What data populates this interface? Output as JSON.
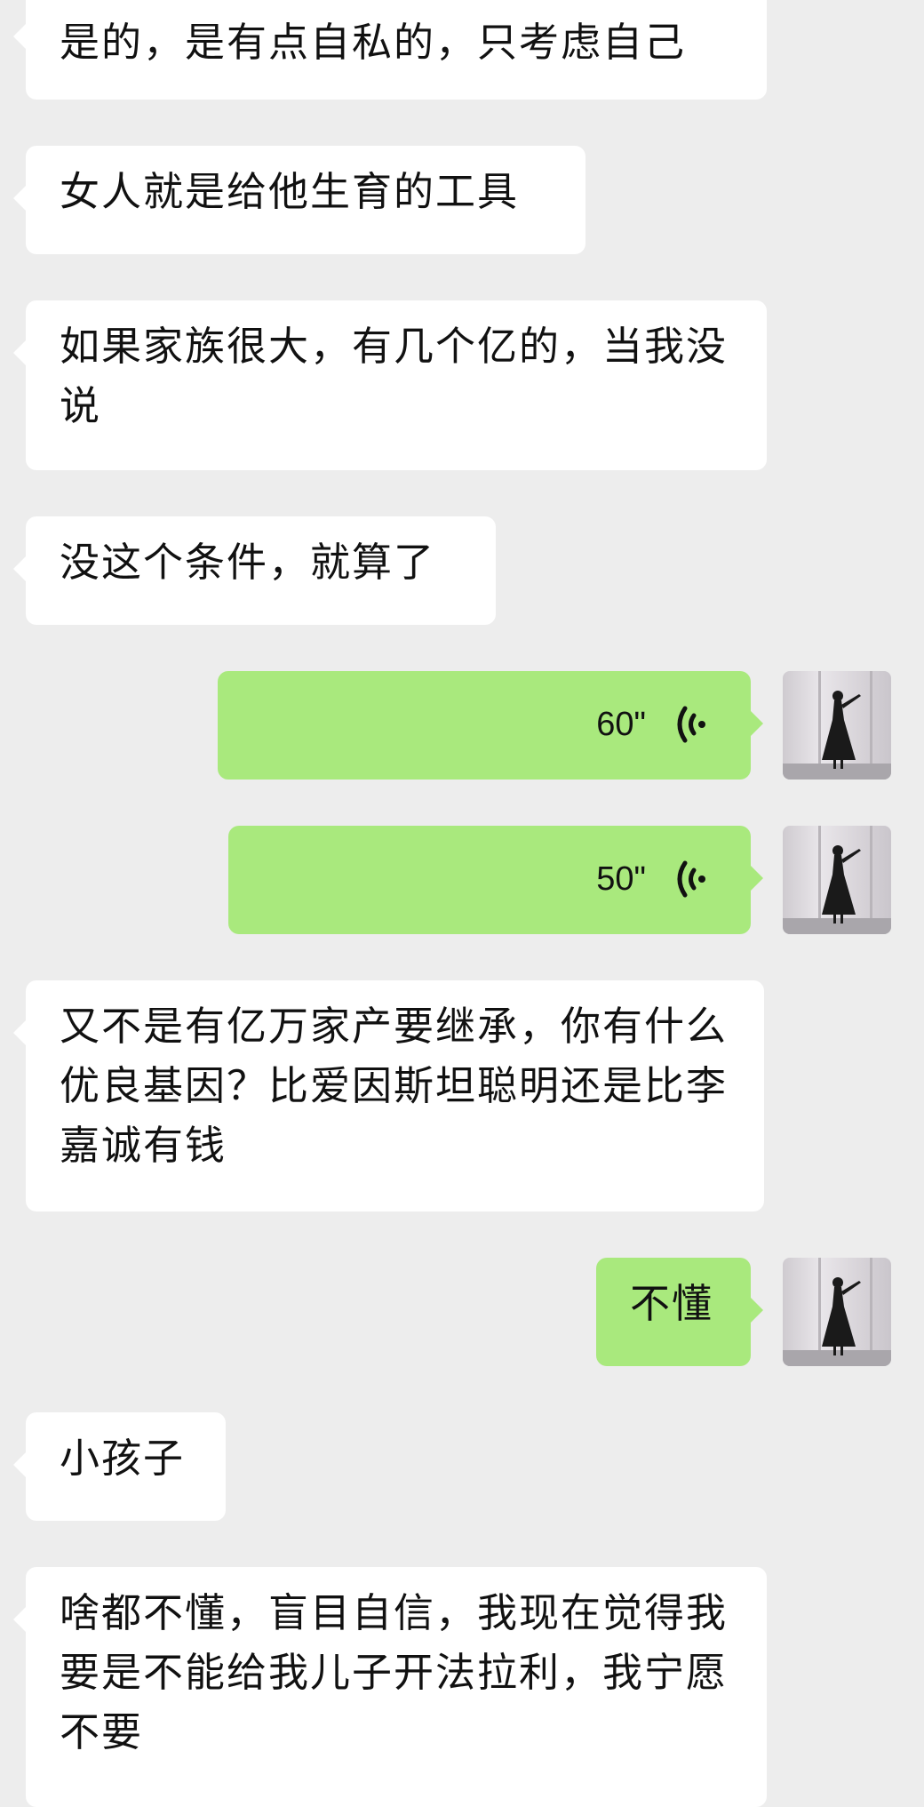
{
  "chat": {
    "messages": [
      {
        "sender": "other",
        "type": "text",
        "text": "是的，是有点自私的，只考虑自己"
      },
      {
        "sender": "other",
        "type": "text",
        "text": "女人就是给他生育的工具"
      },
      {
        "sender": "other",
        "type": "text",
        "text": "如果家族很大，有几个亿的，当我没说"
      },
      {
        "sender": "other",
        "type": "text",
        "text": "没这个条件，就算了"
      },
      {
        "sender": "self",
        "type": "voice",
        "duration": "60\""
      },
      {
        "sender": "self",
        "type": "voice",
        "duration": "50\""
      },
      {
        "sender": "other",
        "type": "text",
        "text": "又不是有亿万家产要继承，你有什么优良基因？比爱因斯坦聪明还是比李嘉诚有钱"
      },
      {
        "sender": "self",
        "type": "text",
        "text": "不懂"
      },
      {
        "sender": "other",
        "type": "text",
        "text": "小孩子"
      },
      {
        "sender": "other",
        "type": "text",
        "text": "啥都不懂，盲目自信，我现在觉得我要是不能给我儿子开法拉利，我宁愿不要"
      }
    ]
  },
  "colors": {
    "background": "#ededed",
    "incoming_bubble": "#ffffff",
    "outgoing_bubble": "#a9e97d",
    "text": "#111111"
  },
  "icons": {
    "voice": "voice-wave-icon",
    "avatar": "user-avatar-silhouette"
  }
}
